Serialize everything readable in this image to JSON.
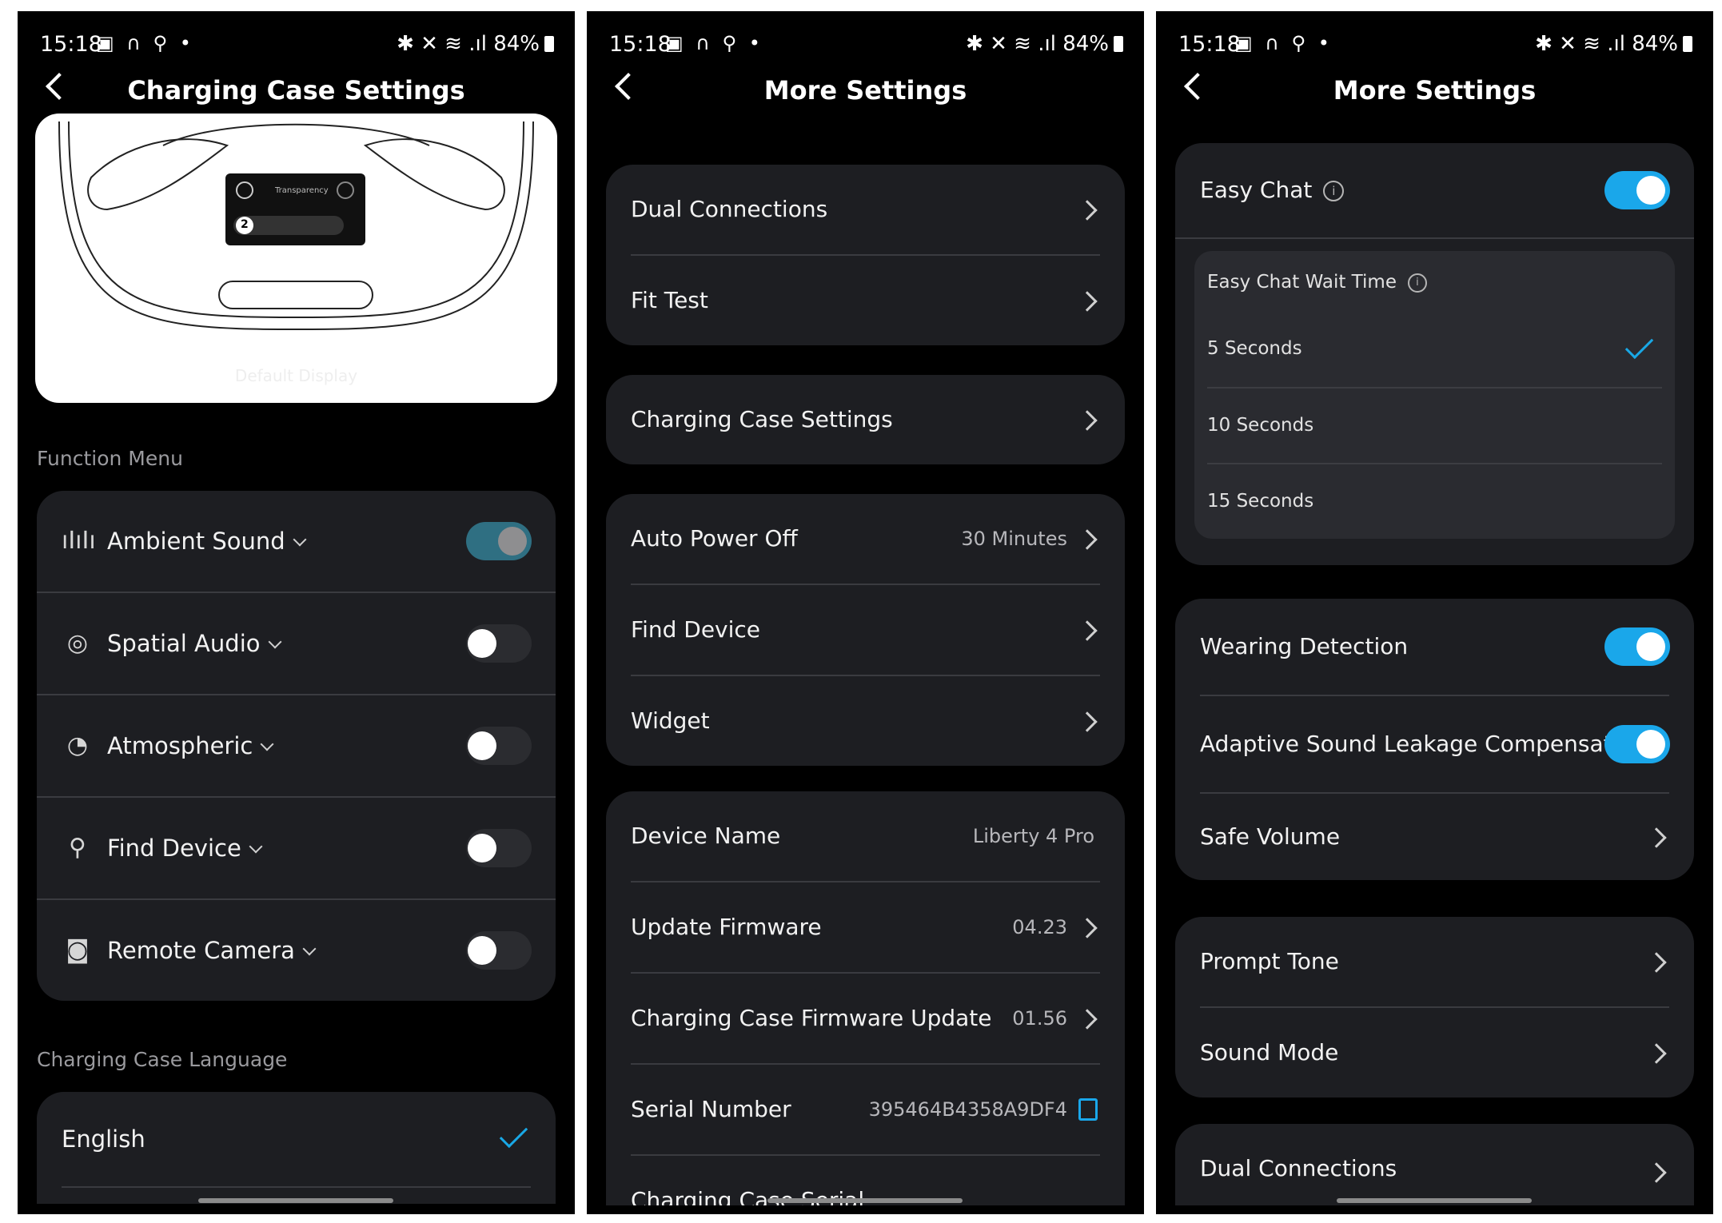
{
  "status": {
    "time": "15:18",
    "left_icons": "▣ ∩ ⚲ •",
    "right_icons": "✱ ✕ ≋ .ıl",
    "battery": "84%"
  },
  "screen1": {
    "title": "Charging Case Settings",
    "illustration": {
      "screen_label": "Transparency",
      "badge": "2",
      "caption": "Default Display"
    },
    "function_menu_label": "Function Menu",
    "function_items": [
      {
        "label": "Ambient Sound",
        "icon": "waveform-icon",
        "enabled": true
      },
      {
        "label": "Spatial Audio",
        "icon": "spatial-audio-icon",
        "enabled": false
      },
      {
        "label": "Atmospheric",
        "icon": "gauge-icon",
        "enabled": false
      },
      {
        "label": "Find Device",
        "icon": "location-pin-icon",
        "enabled": false
      },
      {
        "label": "Remote Camera",
        "icon": "camera-icon",
        "enabled": false
      }
    ],
    "language_label": "Charging Case Language",
    "language_selected": "English"
  },
  "screen2": {
    "title": "More Settings",
    "group1": [
      {
        "label": "Dual Connections"
      },
      {
        "label": "Fit Test"
      }
    ],
    "group2": [
      {
        "label": "Charging Case Settings"
      }
    ],
    "group3": [
      {
        "label": "Auto Power Off",
        "value": "30 Minutes"
      },
      {
        "label": "Find Device"
      },
      {
        "label": "Widget"
      }
    ],
    "group4": [
      {
        "label": "Device Name",
        "value": "Liberty 4 Pro"
      },
      {
        "label": "Update Firmware",
        "value": "04.23"
      },
      {
        "label": "Charging Case Firmware Update",
        "value": "01.56"
      },
      {
        "label": "Serial Number",
        "value": "395464B4358A9DF4"
      },
      {
        "label": "Charging Case Serial"
      }
    ]
  },
  "screen3": {
    "title": "More Settings",
    "easy_chat": {
      "label": "Easy Chat",
      "enabled": true,
      "wait_time_label": "Easy Chat Wait Time",
      "options": [
        "5 Seconds",
        "10 Seconds",
        "15 Seconds"
      ],
      "selected": "5 Seconds"
    },
    "group2": [
      {
        "label": "Wearing Detection",
        "enabled": true
      },
      {
        "label": "Adaptive Sound Leakage Compensation",
        "enabled": true
      },
      {
        "label": "Safe Volume"
      }
    ],
    "group3": [
      {
        "label": "Prompt Tone"
      },
      {
        "label": "Sound Mode"
      }
    ],
    "group4": [
      {
        "label": "Dual Connections"
      }
    ]
  },
  "colors": {
    "accent": "#1aa7ea",
    "card": "#1d1e22",
    "background": "#000000"
  }
}
